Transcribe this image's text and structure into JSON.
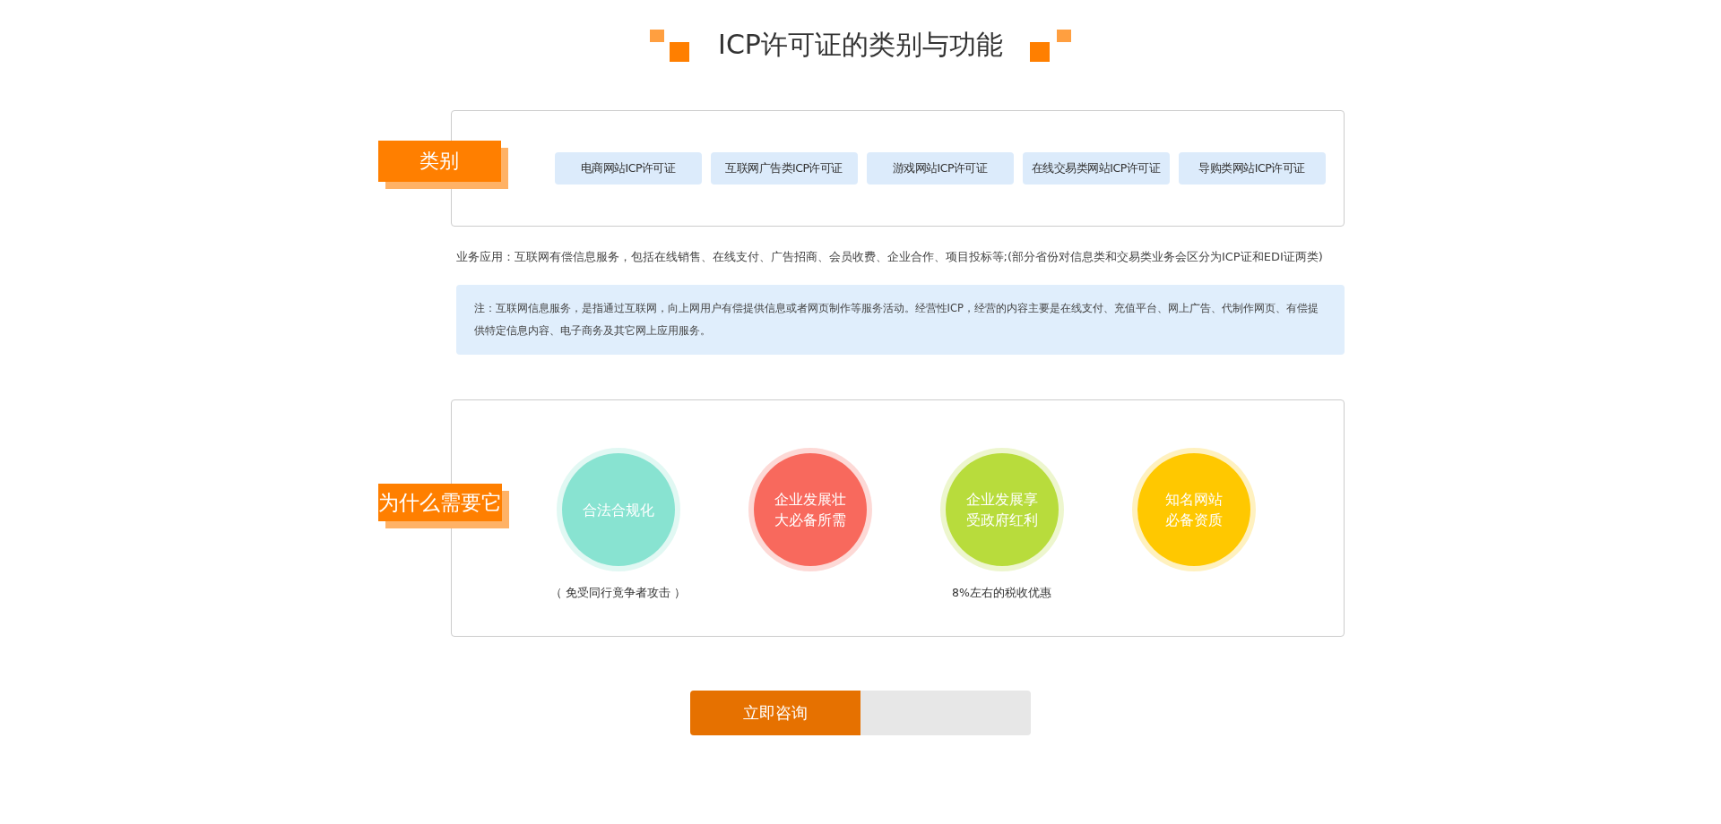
{
  "title": "ICP许可证的类别与功能",
  "categories": {
    "tag": "类别",
    "items": [
      "电商网站ICP许可证",
      "互联网广告类ICP许可证",
      "游戏网站ICP许可证",
      "在线交易类网站ICP许可证",
      "导购类网站ICP许可证"
    ]
  },
  "business_text": "业务应用：互联网有偿信息服务，包括在线销售、在线支付、广告招商、会员收费、企业合作、项目投标等;(部分省份对信息类和交易类业务会区分为ICP证和EDI证两类)",
  "note": "注：互联网信息服务，是指通过互联网，向上网用户有偿提供信息或者网页制作等服务活动。经营性ICP，经营的内容主要是在线支付、充值平台、网上广告、代制作网页、有偿提供特定信息内容、电子商务及其它网上应用服务。",
  "reasons": {
    "tag": "为什么需要它",
    "items": [
      {
        "lines": [
          "合法合规化"
        ],
        "color": "#88e3d1",
        "caption": "（ 免受同行竟争者攻击 ）"
      },
      {
        "lines": [
          "企业发展壮",
          "大必备所需"
        ],
        "color": "#f8695d"
      },
      {
        "lines": [
          "企业发展享",
          "受政府红利"
        ],
        "color": "#b8dc3c",
        "caption": "8%左右的税收优惠"
      },
      {
        "lines": [
          "知名网站",
          "必备资质"
        ],
        "color": "#ffc800"
      }
    ]
  },
  "consult_button": "立即咨询"
}
